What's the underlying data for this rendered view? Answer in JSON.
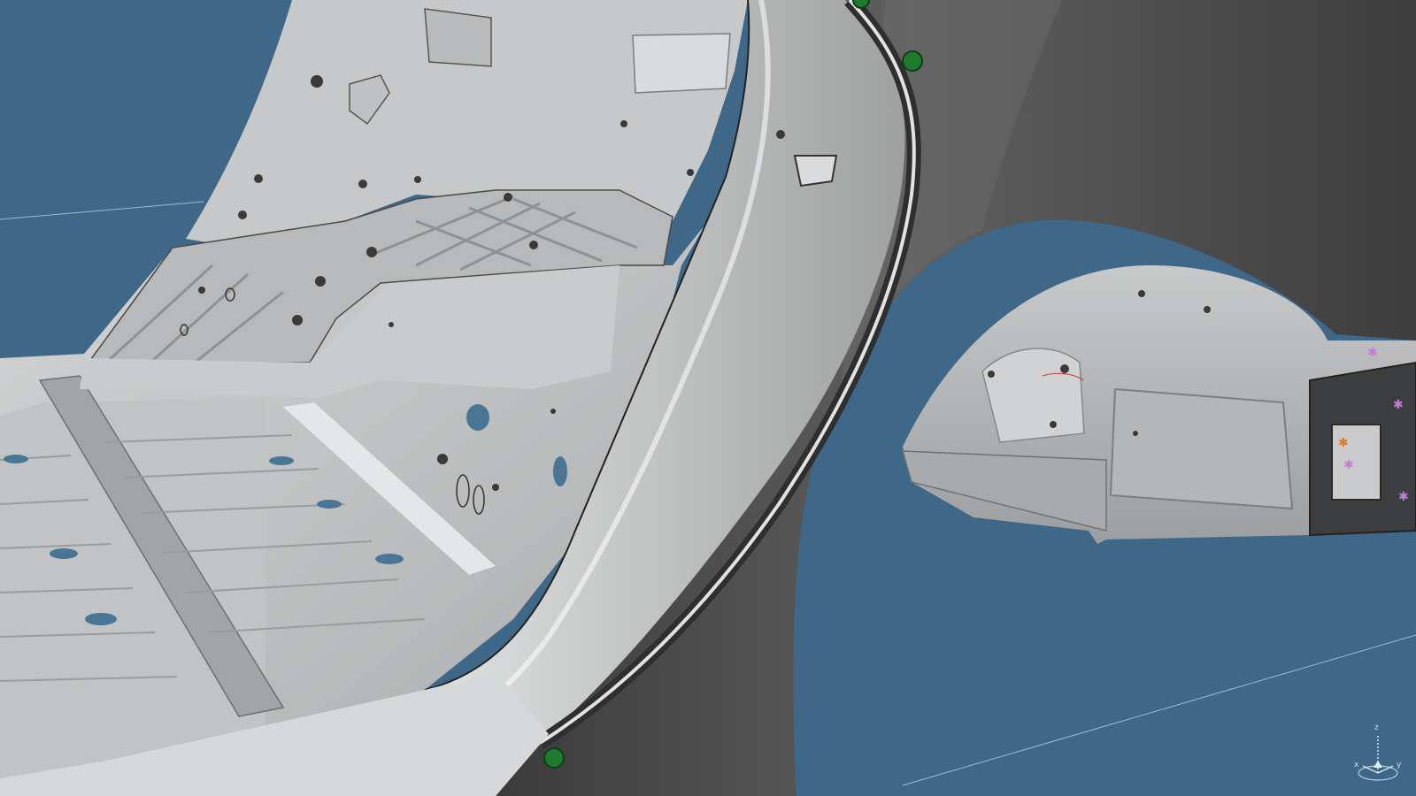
{
  "viewport": {
    "kind": "3D CAD body-in-white viewer",
    "background_color": "#3f6888",
    "body_panel_color": "#b9bbbc",
    "outer_panel_color": "#4a4a4a",
    "seal_color": "#e2e2e2",
    "fastener_color": "#1f7a2e",
    "annotation_colors": [
      "#c77ad6",
      "#e07a23"
    ]
  },
  "compass": {
    "icon": "compass-axis-icon",
    "labels": {
      "x": "x",
      "y": "y",
      "z": "z"
    }
  }
}
